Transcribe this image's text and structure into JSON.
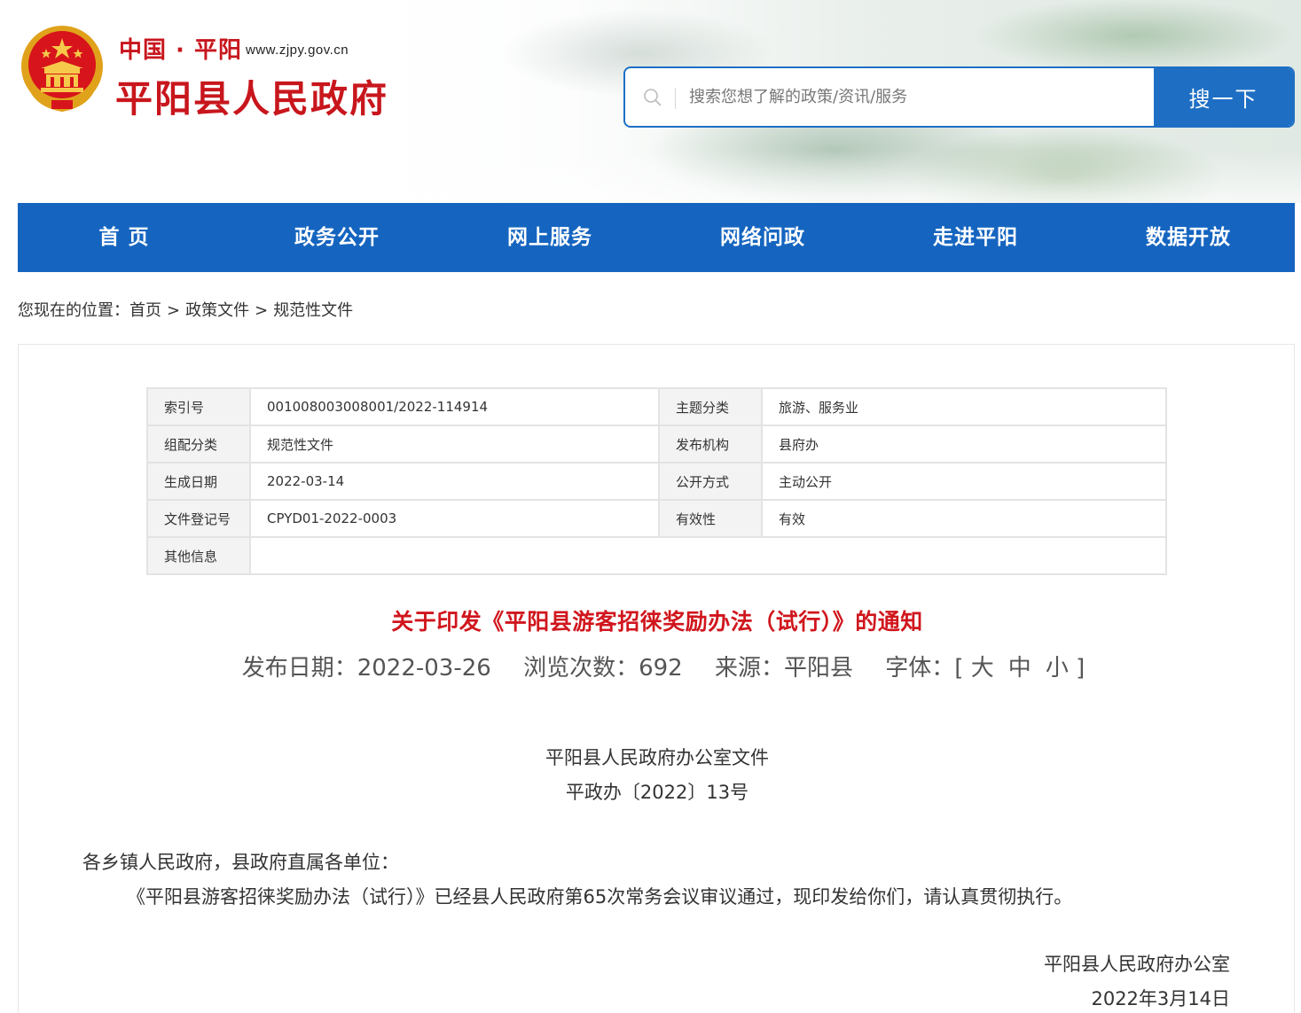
{
  "header": {
    "brand_small": "中国 · 平阳",
    "url": "www.zjpy.gov.cn",
    "brand_big": "平阳县人民政府",
    "emblem_icon": "national-emblem-icon"
  },
  "search": {
    "placeholder": "搜索您想了解的政策/资讯/服务",
    "button": "搜一下",
    "icon": "search-icon"
  },
  "nav": {
    "items": [
      "首 页",
      "政务公开",
      "网上服务",
      "网络问政",
      "走进平阳",
      "数据开放"
    ]
  },
  "breadcrumb": {
    "prefix": "您现在的位置：",
    "items": [
      "首页",
      "政策文件",
      "规范性文件"
    ],
    "separator": ">"
  },
  "meta": {
    "rows": [
      {
        "k1": "索引号",
        "v1": "001008003008001/2022-114914",
        "k2": "主题分类",
        "v2": "旅游、服务业"
      },
      {
        "k1": "组配分类",
        "v1": "规范性文件",
        "k2": "发布机构",
        "v2": "县府办"
      },
      {
        "k1": "生成日期",
        "v1": "2022-03-14",
        "k2": "公开方式",
        "v2": "主动公开"
      },
      {
        "k1": "文件登记号",
        "v1": "CPYD01-2022-0003",
        "k2": "有效性",
        "v2": "有效"
      },
      {
        "k1": "其他信息",
        "v1": ""
      }
    ]
  },
  "article": {
    "title": "关于印发《平阳县游客招徕奖励办法（试行）》的通知",
    "publish_date": "发布日期：2022-03-26",
    "views": "浏览次数：692",
    "source": "来源：平阳县",
    "font_label": "字体：[",
    "font_large": "大",
    "font_medium": "中",
    "font_small": "小",
    "font_close": "]",
    "doc_header": "平阳县人民政府办公室文件",
    "doc_number": "平政办〔2022〕13号",
    "greeting": "各乡镇人民政府，县政府直属各单位：",
    "body": "《平阳县游客招徕奖励办法（试行）》已经县人民政府第65次常务会议审议通过，现印发给你们，请认真贯彻执行。",
    "signer": "平阳县人民政府办公室",
    "sign_date": "2022年3月14日"
  },
  "colors": {
    "brand_red": "#c8161d",
    "nav_blue": "#1565c0",
    "title_red": "#d0161d"
  }
}
